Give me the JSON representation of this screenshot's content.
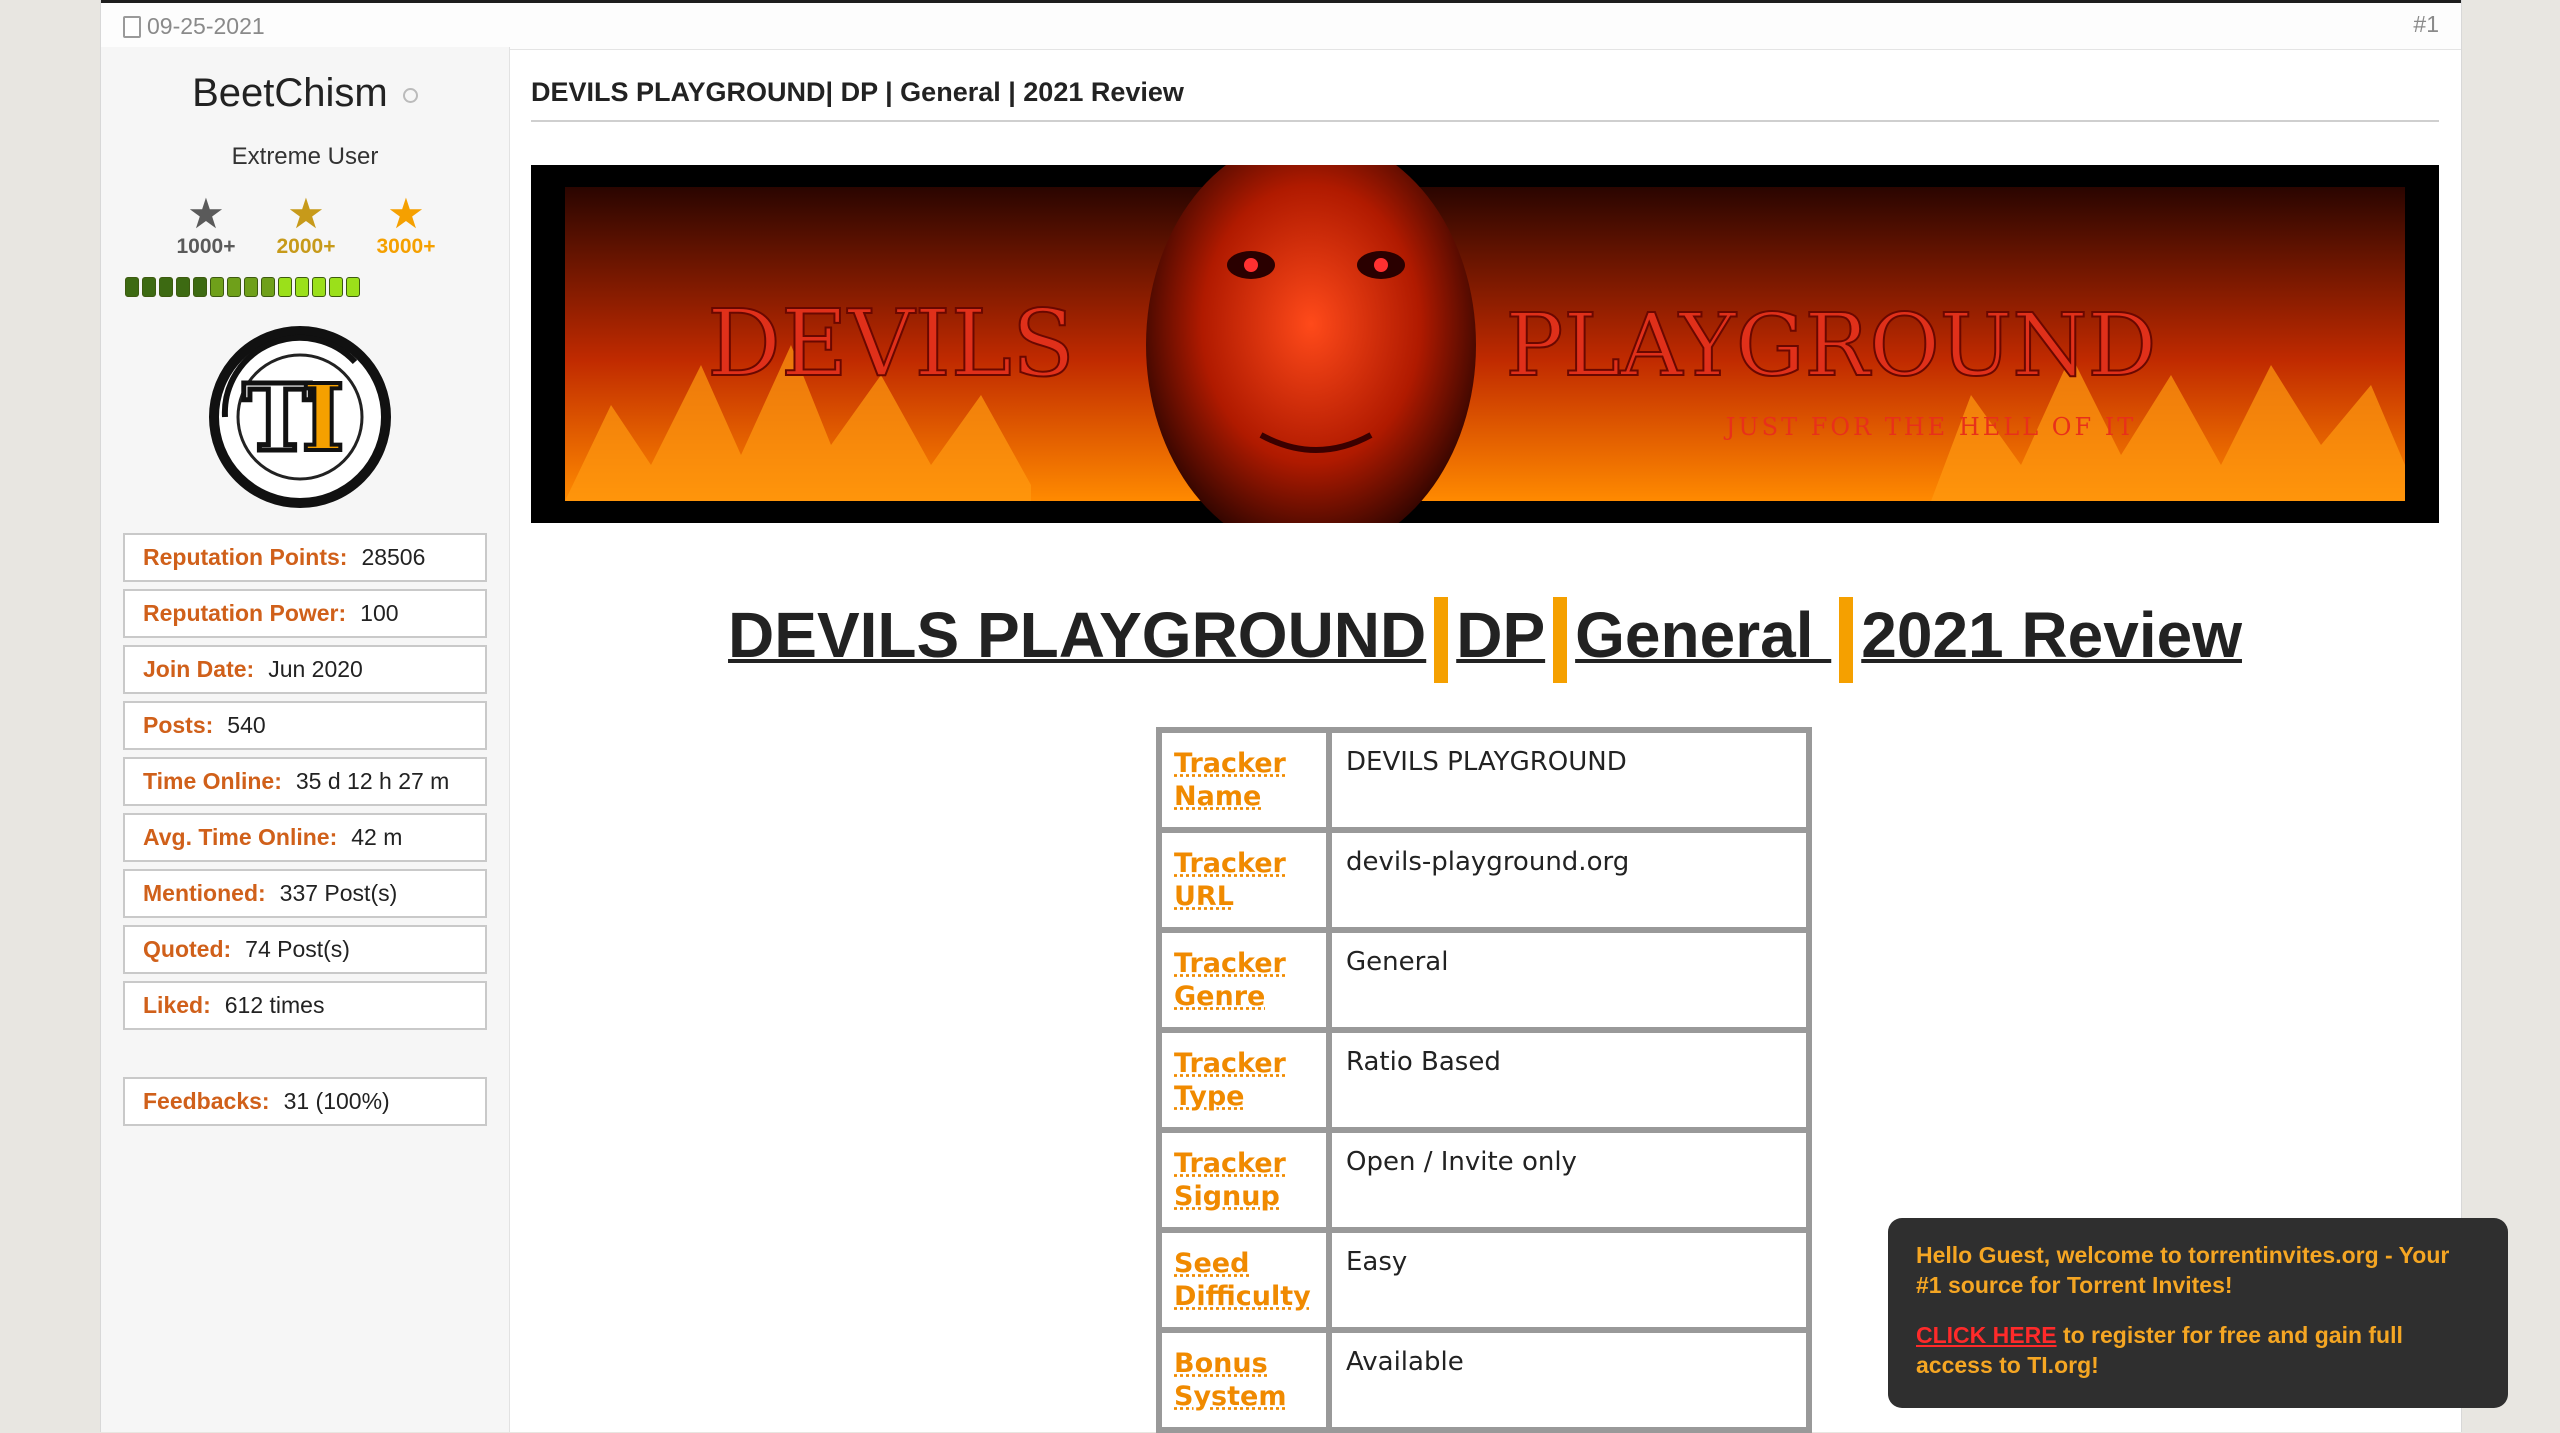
{
  "post": {
    "date": "09-25-2021",
    "number": "#1",
    "title": "DEVILS PLAYGROUND| DP | General | 2021 Review"
  },
  "user": {
    "name": "BeetChism",
    "title": "Extreme User",
    "stars": [
      {
        "label": "1000+",
        "color": "#5a5a5a"
      },
      {
        "label": "2000+",
        "color": "#c79a1a"
      },
      {
        "label": "3000+",
        "color": "#f5a000"
      }
    ],
    "rep_segments_dark": 5,
    "rep_segments_total": 14,
    "avatar_text": "TI",
    "stats": [
      {
        "label": "Reputation Points:",
        "value": "28506"
      },
      {
        "label": "Reputation Power:",
        "value": "100"
      },
      {
        "label": "Join Date:",
        "value": "Jun 2020"
      },
      {
        "label": "Posts:",
        "value": "540"
      },
      {
        "label": "Time Online:",
        "value": "35 d 12 h 27 m"
      },
      {
        "label": "Avg. Time Online:",
        "value": "42 m"
      },
      {
        "label": "Mentioned:",
        "value": "337 Post(s)"
      },
      {
        "label": "Quoted:",
        "value": "74 Post(s)"
      },
      {
        "label": "Liked:",
        "value": "612 times"
      }
    ],
    "feedback": {
      "label": "Feedbacks:",
      "value": "31 (100%)"
    }
  },
  "banner": {
    "left_text": "DEVILS",
    "right_text": "PLAYGROUND",
    "tagline": "JUST FOR THE HELL OF IT"
  },
  "heading": {
    "parts": [
      "DEVILS PLAYGROUND",
      "DP",
      "General ",
      "2021 Review"
    ]
  },
  "info_table": [
    {
      "key": "Tracker Name",
      "value": "DEVILS PLAYGROUND"
    },
    {
      "key": "Tracker URL",
      "value": "devils-playground.org"
    },
    {
      "key": "Tracker Genre",
      "value": "General"
    },
    {
      "key": "Tracker Type",
      "value": "Ratio Based"
    },
    {
      "key": "Tracker Signup",
      "value": "Open / Invite only"
    },
    {
      "key": "Seed Difficulty",
      "value": "Easy"
    },
    {
      "key": "Bonus System",
      "value": "Available"
    }
  ],
  "popup": {
    "line1": "Hello Guest, welcome to torrentinvites.org - Your #1 source for Torrent Invites!",
    "link": "CLICK HERE",
    "line2": " to register for free and gain full access to TI.org!"
  },
  "colors": {
    "accent_orange": "#f08a00",
    "label_orange": "#d0601a",
    "popup_bg": "#2f2f2f",
    "rep_dark": "#3d6a12",
    "rep_light": "#9be01a"
  }
}
